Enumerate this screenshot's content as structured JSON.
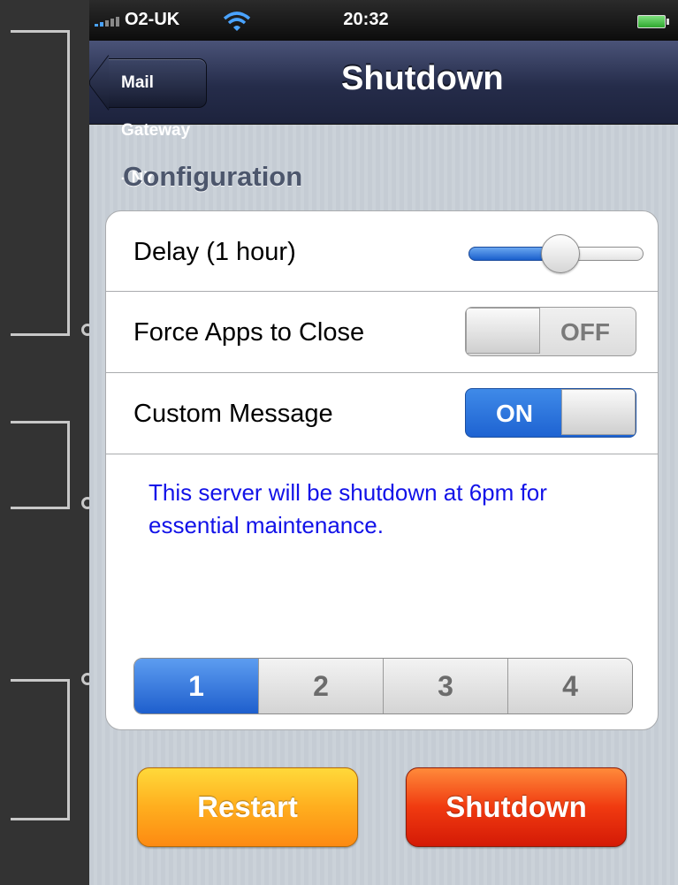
{
  "status_bar": {
    "carrier": "O2-UK",
    "time": "20:32",
    "icons": [
      "signal-icon",
      "wifi-icon",
      "battery-icon"
    ]
  },
  "nav_bar": {
    "back_label": "Mail Gateway - NY",
    "title": "Shutdown"
  },
  "section": {
    "header": "Configuration"
  },
  "settings": {
    "delay": {
      "label": "Delay (1 hour)",
      "slider_fraction": 0.52
    },
    "force_apps": {
      "label": "Force Apps to Close",
      "state": "OFF"
    },
    "custom_message": {
      "label": "Custom Message",
      "state": "ON"
    },
    "message_text": "This server will be shutdown at 6pm for essential maintenance."
  },
  "segments": {
    "options": [
      "1",
      "2",
      "3",
      "4"
    ],
    "selected_index": 0
  },
  "buttons": {
    "restart": "Restart",
    "shutdown": "Shutdown"
  },
  "colors": {
    "nav_bar": "#252c4a",
    "accent_blue": "#1e63d2",
    "message_text": "#1212e8",
    "restart": "#ffae1e",
    "shutdown": "#f03a10"
  }
}
